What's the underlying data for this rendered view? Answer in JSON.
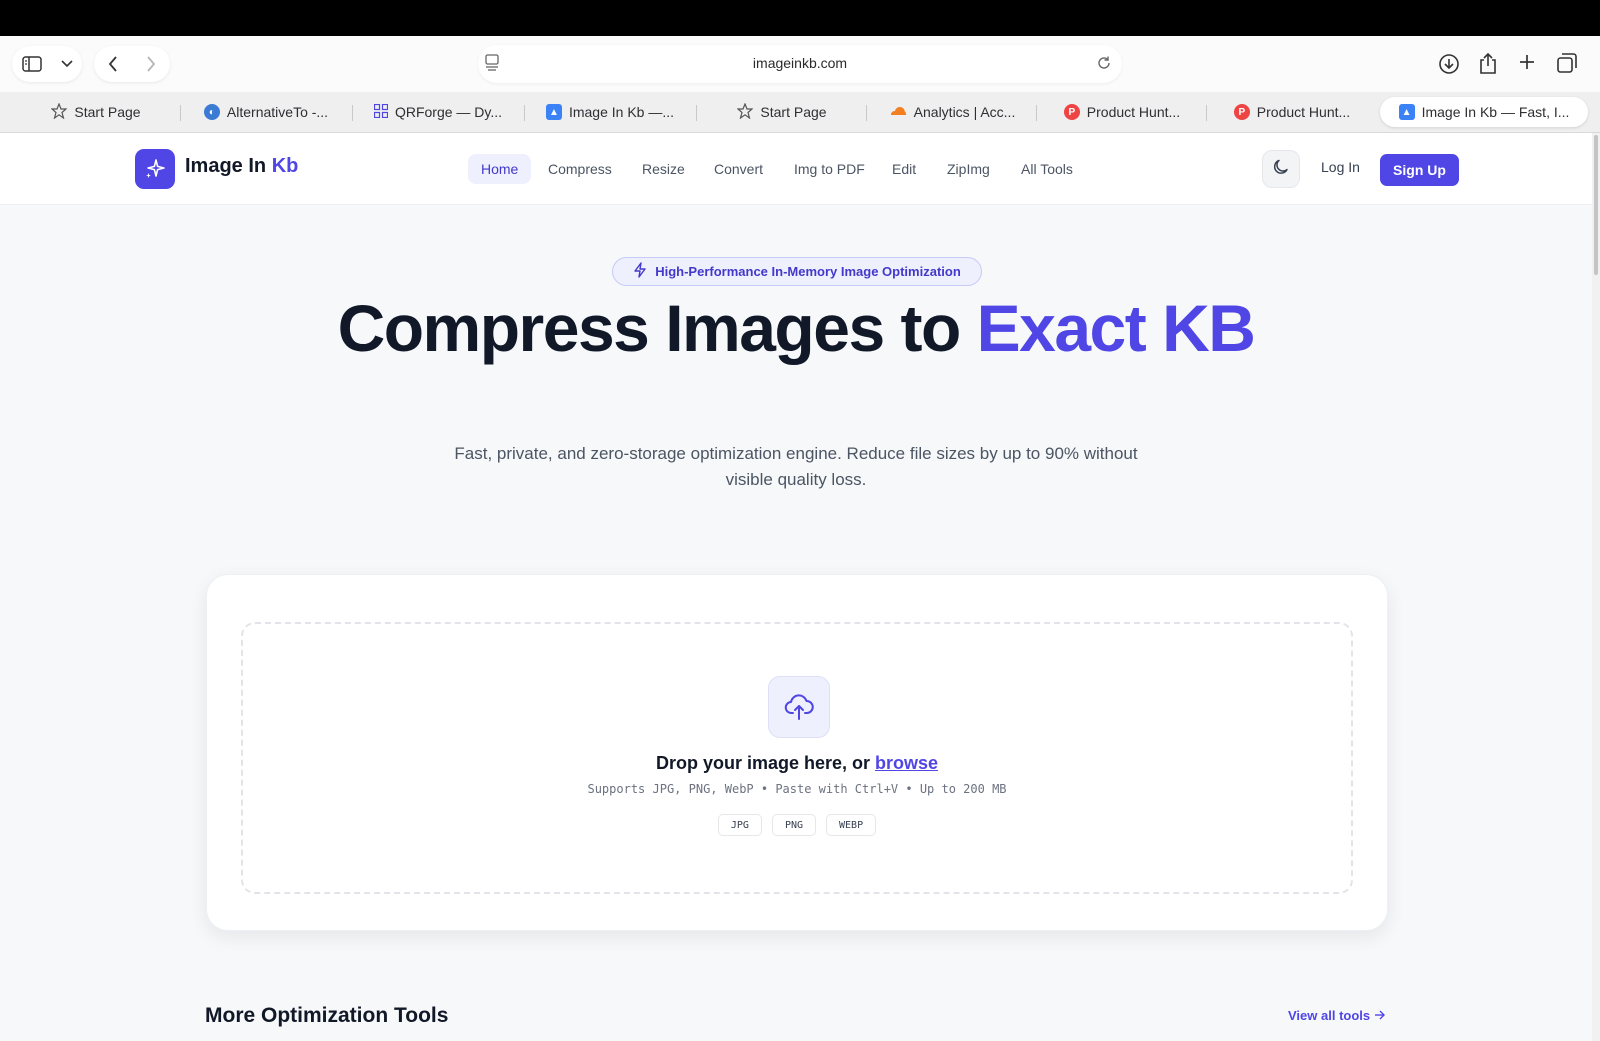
{
  "browser": {
    "url": "imageinkb.com",
    "tabs": [
      {
        "label": "Start Page",
        "icon": "star-icon"
      },
      {
        "label": "AlternativeTo -...",
        "icon": "alternativeto-icon"
      },
      {
        "label": "QRForge — Dy...",
        "icon": "qr-grid-icon"
      },
      {
        "label": "Image In Kb —...",
        "icon": "image-in-kb-icon"
      },
      {
        "label": "Start Page",
        "icon": "star-icon"
      },
      {
        "label": "Analytics | Acc...",
        "icon": "cloudflare-icon"
      },
      {
        "label": "Product Hunt...",
        "icon": "product-hunt-icon"
      },
      {
        "label": "Product Hunt...",
        "icon": "product-hunt-icon"
      },
      {
        "label": "Image In Kb — Fast, I...",
        "icon": "image-in-kb-icon",
        "active": true
      }
    ]
  },
  "site": {
    "brand_main": "Image In ",
    "brand_accent": "Kb",
    "nav": [
      "Home",
      "Compress",
      "Resize",
      "Convert",
      "Img to PDF",
      "Edit",
      "ZipImg",
      "All Tools"
    ],
    "active_nav": "Home",
    "login_label": "Log In",
    "signup_label": "Sign Up"
  },
  "hero": {
    "badge": "High-Performance In-Memory Image Optimization",
    "title_main": "Compress Images to ",
    "title_accent": "Exact KB",
    "subtitle": "Fast, private, and zero-storage optimization engine. Reduce file sizes by up to 90% without visible quality loss."
  },
  "upload": {
    "title_prefix": "Drop your image here, or ",
    "browse_label": "browse",
    "hint": "Supports JPG, PNG, WebP • Paste with Ctrl+V • Up to 200 MB",
    "formats": [
      "JPG",
      "PNG",
      "WEBP"
    ]
  },
  "more_tools": {
    "title": "More Optimization Tools",
    "view_all": "View all tools"
  },
  "colors": {
    "accent": "#4f46e5",
    "page_bg": "#f7f8fa"
  }
}
